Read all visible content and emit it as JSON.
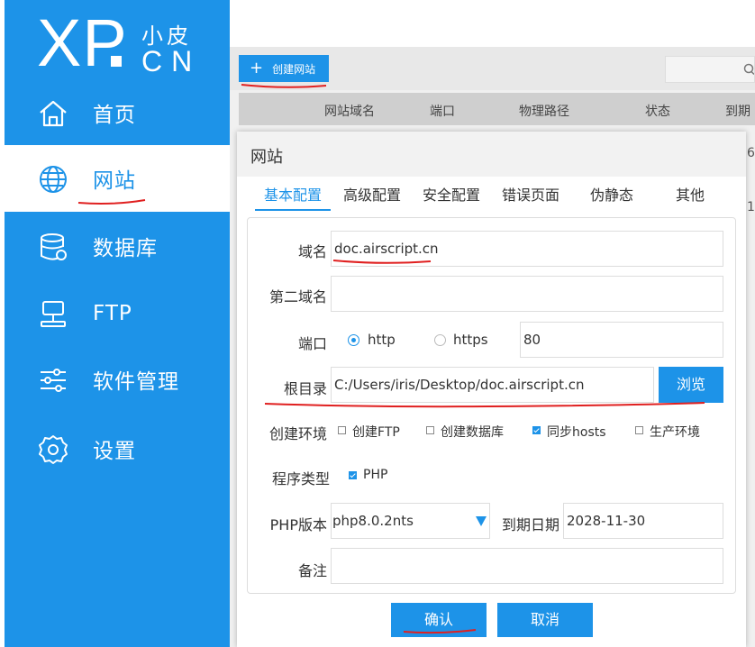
{
  "colors": {
    "brand": "#1d93e8",
    "annotation": "#e02020",
    "sidebar_active_bg": "#ffffff"
  },
  "logo": {
    "main": "XP",
    "small": "小皮",
    "suffix": "CN"
  },
  "sidebar": {
    "items": [
      {
        "label": "首页",
        "icon": "home-icon",
        "active": false
      },
      {
        "label": "网站",
        "icon": "globe-icon",
        "active": true
      },
      {
        "label": "数据库",
        "icon": "database-icon",
        "active": false
      },
      {
        "label": "FTP",
        "icon": "ftp-server-icon",
        "active": false
      },
      {
        "label": "软件管理",
        "icon": "sliders-icon",
        "active": false
      },
      {
        "label": "设置",
        "icon": "gear-icon",
        "active": false
      }
    ]
  },
  "toolbar": {
    "create_label": "创建网站",
    "create_icon": "plus-icon",
    "search_icon": "search-icon"
  },
  "table": {
    "headers": [
      "网站域名",
      "端口",
      "物理路径",
      "状态",
      "到期"
    ],
    "peek_values": [
      "6",
      "1"
    ]
  },
  "dialog": {
    "title": "网站",
    "tabs": [
      "基本配置",
      "高级配置",
      "安全配置",
      "错误页面",
      "伪静态",
      "其他"
    ],
    "active_tab": 0,
    "form": {
      "domain": {
        "label": "域名",
        "value": "doc.airscript.cn"
      },
      "second_domain": {
        "label": "第二域名",
        "value": ""
      },
      "port": {
        "label": "端口",
        "options": [
          {
            "label": "http",
            "checked": true
          },
          {
            "label": "https",
            "checked": false
          }
        ],
        "value": "80"
      },
      "root": {
        "label": "根目录",
        "value": "C:/Users/iris/Desktop/doc.airscript.cn",
        "browse_label": "浏览"
      },
      "env": {
        "label": "创建环境",
        "options": [
          {
            "label": "创建FTP",
            "checked": false
          },
          {
            "label": "创建数据库",
            "checked": false
          },
          {
            "label": "同步hosts",
            "checked": true
          },
          {
            "label": "生产环境",
            "checked": false
          }
        ]
      },
      "program": {
        "label": "程序类型",
        "options": [
          {
            "label": "PHP",
            "checked": true
          }
        ]
      },
      "php_version": {
        "label": "PHP版本",
        "value": "php8.0.2nts"
      },
      "expiry": {
        "label": "到期日期",
        "value": "2028-11-30"
      },
      "note": {
        "label": "备注",
        "value": ""
      }
    },
    "confirm_label": "确认",
    "cancel_label": "取消"
  }
}
